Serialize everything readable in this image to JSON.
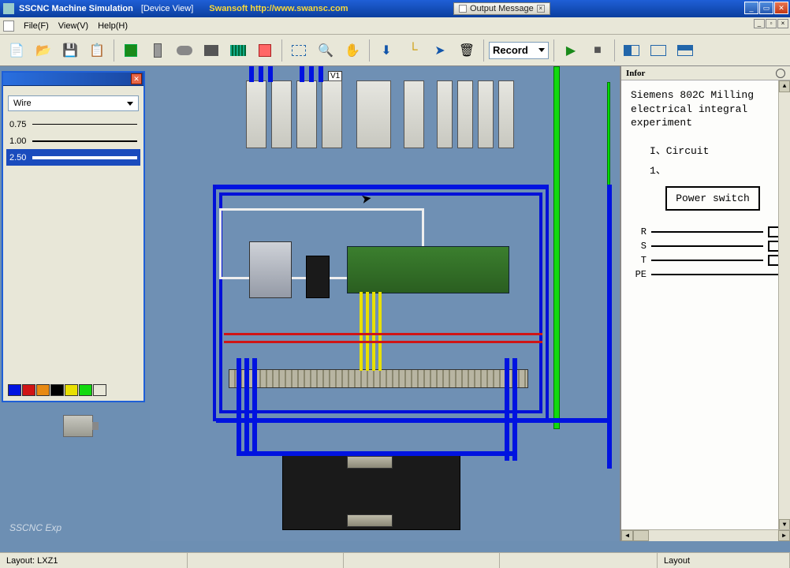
{
  "title": "SSCNC Machine Simulation",
  "subtitle": "[Device View]",
  "brand": "Swansoft http://www.swansc.com",
  "out_tab": "Output Message",
  "menu": {
    "file": "File(F)",
    "view": "View(V)",
    "help": "Help(H)"
  },
  "toolbar": {
    "record": "Record"
  },
  "wire": {
    "label": "Wire",
    "sizes": [
      "0.75",
      "1.00",
      "2.50"
    ],
    "selected": "2.50",
    "colors": [
      "#0013e0",
      "#d01515",
      "#e88a12",
      "#000000",
      "#e8e000",
      "#12d90e",
      "#e8e7d8"
    ]
  },
  "canvas": {
    "marker": "V1"
  },
  "info": {
    "title": "Infor",
    "body_l1": "Siemens 802C Milling electrical integral experiment",
    "sec1": "I、Circuit",
    "sec1_1": "1、",
    "powersw": "Power switch",
    "rails": [
      "R",
      "S",
      "T",
      "PE"
    ]
  },
  "status": {
    "layout": "Layout: LXZ1",
    "layout_r": "Layout"
  },
  "watermark": "SSCNC Exp"
}
